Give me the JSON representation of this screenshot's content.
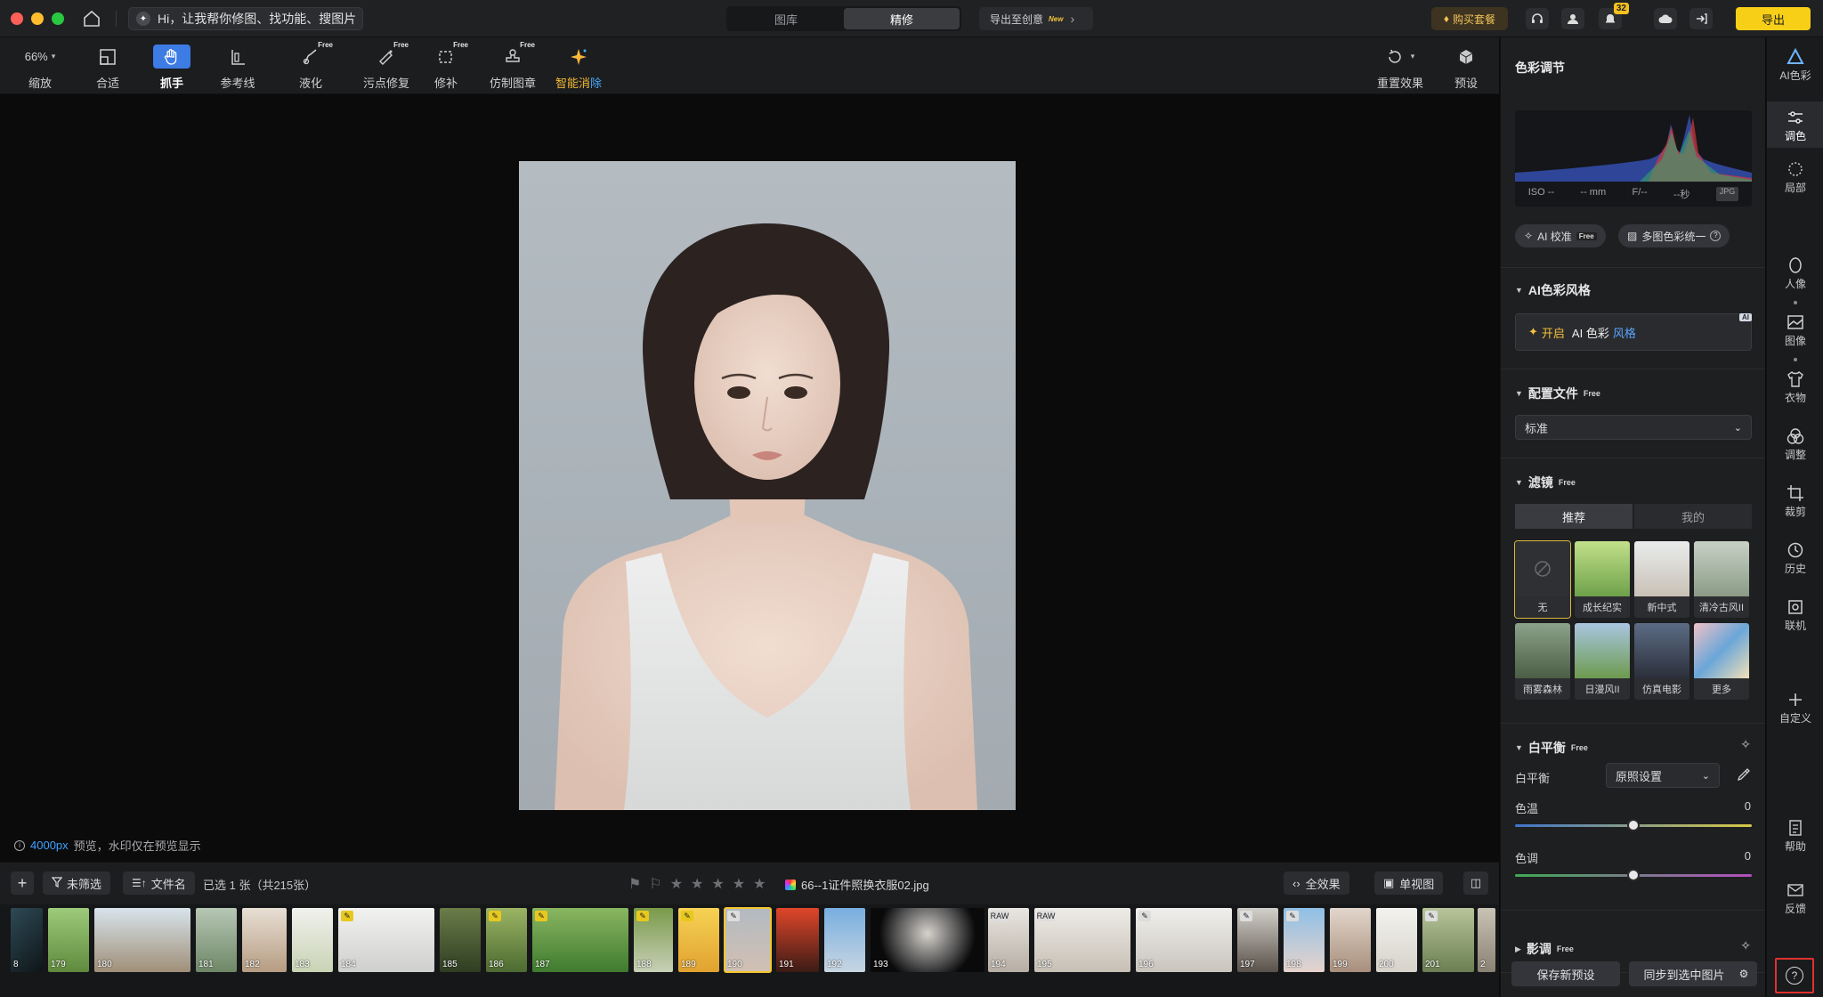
{
  "titlebar": {
    "search_placeholder": "Hi，让我帮你修图、找功能、搜图片",
    "tabs": [
      "图库",
      "精修"
    ],
    "active_tab": "精修",
    "export_creative": "导出至创意",
    "new_badge": "New",
    "buy_label": "购买套餐",
    "notification_count": "32",
    "export_label": "导出"
  },
  "toolbar": {
    "zoom": "66%",
    "tools": [
      {
        "label": "缩放"
      },
      {
        "label": "合适"
      },
      {
        "label": "抓手"
      },
      {
        "label": "参考线"
      },
      {
        "label": "液化",
        "tag": "Free"
      },
      {
        "label": "污点修复",
        "tag": "Free"
      },
      {
        "label": "修补",
        "tag": "Free"
      },
      {
        "label": "仿制图章",
        "tag": "Free"
      },
      {
        "label_a": "智能消",
        "label_b": "除"
      }
    ],
    "reset_effect": "重置效果",
    "preset": "预设"
  },
  "canvas": {
    "preview_px": "4000px",
    "preview_note": "预览，水印仅在预览显示"
  },
  "filmstrip": {
    "filter_label": "未筛选",
    "sort_label": "文件名",
    "selection_info": "已选 1 张（共215张）",
    "filename": "66--1证件照换衣服02.jpg",
    "all_effects": "全效果",
    "single_view": "单视图",
    "thumbs": [
      {
        "num": "8"
      },
      {
        "num": "179"
      },
      {
        "num": "180"
      },
      {
        "num": "181"
      },
      {
        "num": "182"
      },
      {
        "num": "183"
      },
      {
        "num": "184"
      },
      {
        "num": "185"
      },
      {
        "num": "186"
      },
      {
        "num": "187"
      },
      {
        "num": "188"
      },
      {
        "num": "189"
      },
      {
        "num": "190"
      },
      {
        "num": "191"
      },
      {
        "num": "192"
      },
      {
        "num": "193"
      },
      {
        "num": "194",
        "tag": "RAW"
      },
      {
        "num": "195",
        "tag": "RAW"
      },
      {
        "num": "196"
      },
      {
        "num": "197"
      },
      {
        "num": "198"
      },
      {
        "num": "199"
      },
      {
        "num": "200"
      },
      {
        "num": "201"
      },
      {
        "num": "2"
      }
    ]
  },
  "panel": {
    "title": "色彩调节",
    "exif": {
      "iso": "ISO --",
      "mm": "-- mm",
      "f": "F/--",
      "sec": "--秒",
      "fmt": "JPG"
    },
    "ai_calibrate": "AI 校准",
    "free": "Free",
    "multi_unify": "多图色彩统一",
    "ai_style_section": "AI色彩风格",
    "ai_style_open": "开启",
    "ai_style_ai": "AI 色彩",
    "ai_style_word": "风格",
    "ai_corner": "AI",
    "profile_section": "配置文件",
    "profile_value": "标准",
    "filter_section": "滤镜",
    "filter_tabs": [
      "推荐",
      "我的"
    ],
    "filters": [
      "无",
      "成长纪实",
      "新中式",
      "清冷古风II",
      "雨雾森林",
      "日漫风II",
      "仿真电影",
      "更多"
    ],
    "wb_section": "白平衡",
    "wb_label": "白平衡",
    "wb_value": "原照设置",
    "temp_label": "色温",
    "temp_value": "0",
    "tint_label": "色调",
    "tint_value": "0",
    "shadow_section": "影调",
    "save_preset": "保存新预设",
    "sync_selected": "同步到选中图片"
  },
  "rail": {
    "items": [
      "AI色彩",
      "调色",
      "局部",
      "人像",
      "图像",
      "衣物",
      "调整",
      "裁剪",
      "历史",
      "联机",
      "自定义",
      "帮助",
      "反馈"
    ]
  },
  "colors": {
    "accent_blue": "#3d7be5",
    "export_yellow": "#f7cf16",
    "highlight_red": "#e0322f"
  }
}
